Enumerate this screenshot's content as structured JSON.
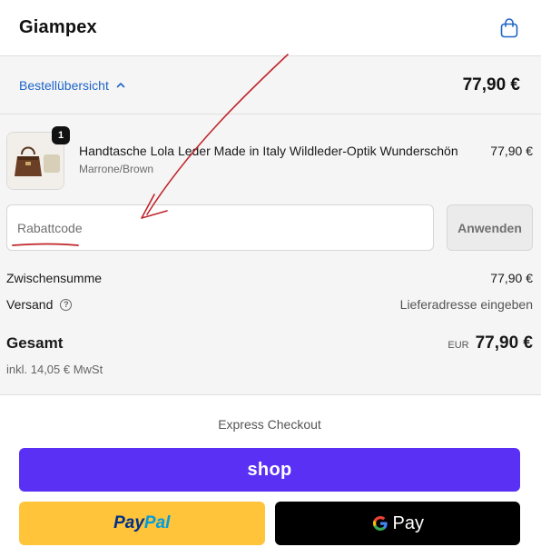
{
  "header": {
    "brand": "Giampex",
    "cart_icon": "shopping-bag-icon"
  },
  "summary": {
    "toggle_label": "Bestellübersicht",
    "toggle_icon": "chevron-up-icon",
    "total": "77,90 €"
  },
  "line_item": {
    "quantity": "1",
    "title": "Handtasche Lola Leder Made in Italy Wildleder-Optik Wunderschön",
    "variant": "Marrone/Brown",
    "price": "77,90 €"
  },
  "discount": {
    "placeholder": "Rabattcode",
    "apply_label": "Anwenden"
  },
  "totals": {
    "subtotal_label": "Zwischensumme",
    "subtotal_value": "77,90 €",
    "shipping_label": "Versand",
    "shipping_value": "Lieferadresse eingeben",
    "total_label": "Gesamt",
    "currency": "EUR",
    "total_value": "77,90 €",
    "tax_note": "inkl. 14,05 € MwSt"
  },
  "express": {
    "title": "Express Checkout",
    "shop_label": "shop",
    "paypal_part1": "Pay",
    "paypal_part2": "Pal",
    "gpay_label": "Pay"
  },
  "colors": {
    "link": "#1e64c8",
    "shop": "#5a31f4",
    "paypal": "#ffc439",
    "annotation": "#c0262b"
  }
}
